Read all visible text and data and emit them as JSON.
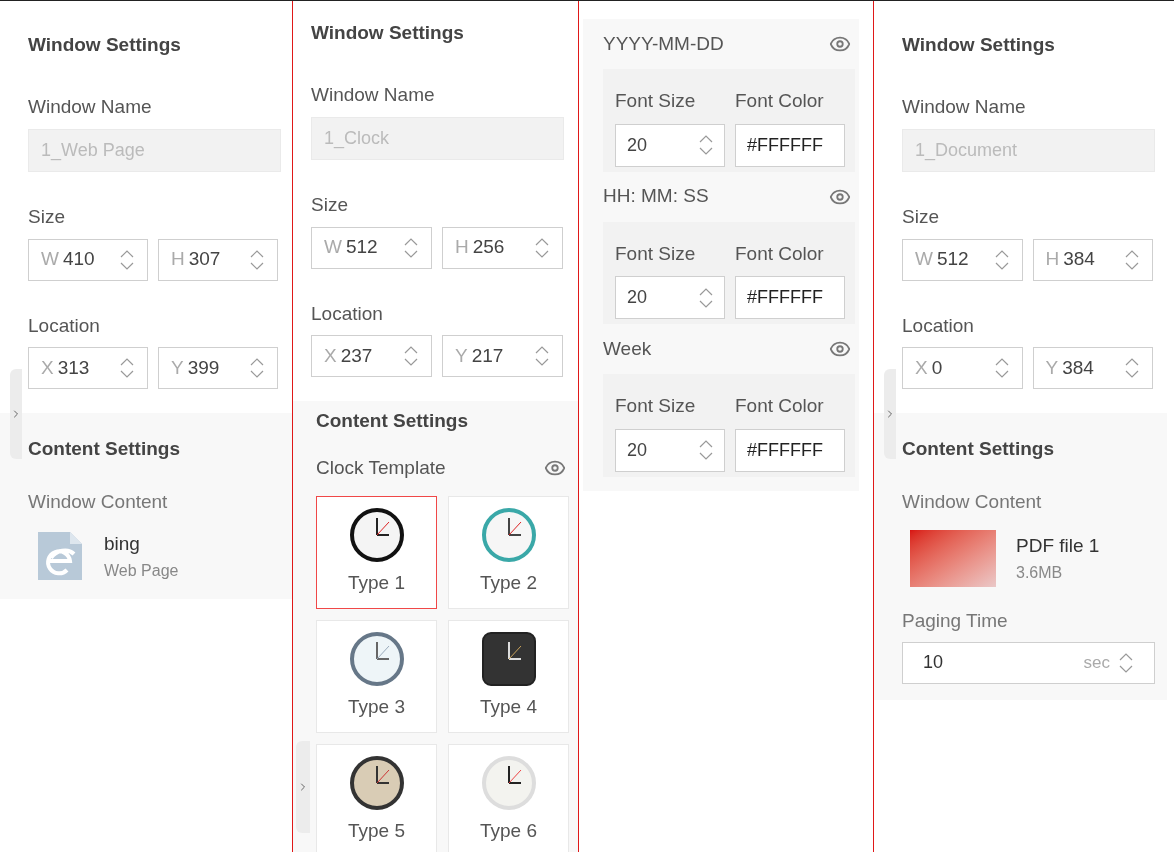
{
  "panels": [
    {
      "kind": "window",
      "window_settings": {
        "title": "Window Settings",
        "name_label": "Window Name",
        "name_value": "1_Web Page",
        "size_label": "Size",
        "size": [
          {
            "prefix": "W",
            "value": "410"
          },
          {
            "prefix": "H",
            "value": "307"
          }
        ],
        "location_label": "Location",
        "location": [
          {
            "prefix": "X",
            "value": "313"
          },
          {
            "prefix": "Y",
            "value": "399"
          }
        ]
      },
      "content": {
        "title": "Content Settings",
        "label": "Window Content",
        "file": {
          "kind": "web",
          "name": "bing",
          "info": "Web Page"
        }
      }
    },
    {
      "kind": "clock",
      "window_settings": {
        "title": "Window Settings",
        "name_label": "Window Name",
        "name_value": "1_Clock",
        "size_label": "Size",
        "size": [
          {
            "prefix": "W",
            "value": "512"
          },
          {
            "prefix": "H",
            "value": "256"
          }
        ],
        "location_label": "Location",
        "location": [
          {
            "prefix": "X",
            "value": "237"
          },
          {
            "prefix": "Y",
            "value": "217"
          }
        ]
      },
      "content": {
        "title": "Content Settings",
        "template_label": "Clock Template",
        "templates": [
          {
            "label": "Type 1",
            "selected": true
          },
          {
            "label": "Type 2",
            "selected": false
          },
          {
            "label": "Type 3",
            "selected": false
          },
          {
            "label": "Type 4",
            "selected": false
          },
          {
            "label": "Type 5",
            "selected": false
          },
          {
            "label": "Type 6",
            "selected": false
          }
        ]
      }
    },
    {
      "kind": "formats",
      "formats": [
        {
          "label": "YYYY-MM-DD",
          "font_size_label": "Font Size",
          "font_size": "20",
          "font_color_label": "Font Color",
          "font_color": "#FFFFFF"
        },
        {
          "label": "HH: MM: SS",
          "font_size_label": "Font Size",
          "font_size": "20",
          "font_color_label": "Font Color",
          "font_color": "#FFFFFF"
        },
        {
          "label": "Week",
          "font_size_label": "Font Size",
          "font_size": "20",
          "font_color_label": "Font Color",
          "font_color": "#FFFFFF"
        }
      ]
    },
    {
      "kind": "window",
      "window_settings": {
        "title": "Window Settings",
        "name_label": "Window Name",
        "name_value": "1_Document",
        "size_label": "Size",
        "size": [
          {
            "prefix": "W",
            "value": "512"
          },
          {
            "prefix": "H",
            "value": "384"
          }
        ],
        "location_label": "Location",
        "location": [
          {
            "prefix": "X",
            "value": "0"
          },
          {
            "prefix": "Y",
            "value": "384"
          }
        ]
      },
      "content": {
        "title": "Content Settings",
        "label": "Window Content",
        "file": {
          "kind": "pdf",
          "name": "PDF file 1",
          "info": "3.6MB"
        },
        "paging_label": "Paging Time",
        "paging_value": "10",
        "paging_unit": "sec"
      }
    }
  ]
}
